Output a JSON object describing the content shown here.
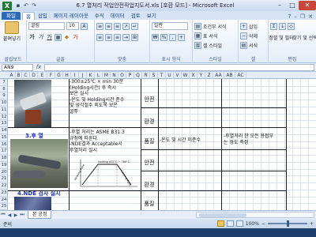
{
  "window": {
    "title": "6.7 열처리 작업안전작업지도서.xls [호환 모드] - Microsoft Excel",
    "app_icon": "X"
  },
  "ribbon_tabs": [
    "파일",
    "홈",
    "삽입",
    "페이지 레이아웃",
    "수식",
    "데이터",
    "검토",
    "보기"
  ],
  "ribbon": {
    "clipboard": {
      "label": "클립보드",
      "paste": "붙여넣기"
    },
    "font": {
      "label": "글꼴",
      "name": "굴림",
      "size": "10"
    },
    "alignment": {
      "label": "맞춤"
    },
    "number": {
      "label": "표시 형식",
      "format": "일반"
    },
    "styles": {
      "label": "스타일",
      "conditional": "조건부 서식",
      "table": "표 서식",
      "cell": "셀 스타일"
    },
    "cells": {
      "label": "셀",
      "insert": "삽입",
      "delete": "삭제",
      "format": "서식"
    },
    "editing": {
      "label": "편집",
      "sort": "정렬 및 필터",
      "find": "찾기 및 선택"
    }
  },
  "formula_bar": {
    "name_box": "AN9",
    "fx": "fx",
    "formula": ""
  },
  "columns": [
    "A",
    "B",
    "C",
    "D",
    "E",
    "F",
    "G",
    "H",
    "I",
    "J",
    "K",
    "L",
    "M",
    "N",
    "O",
    "P",
    "Q",
    "R",
    "S",
    "T",
    "U",
    "V",
    "W",
    "X",
    "Y",
    "Z",
    "AA",
    "AB",
    "AC"
  ],
  "rows": [
    "7",
    "8",
    "9",
    "10",
    "11",
    "12",
    "13",
    "14",
    "15",
    "16",
    "17",
    "18",
    "19",
    "20",
    "21",
    "22",
    "23",
    "24",
    "25"
  ],
  "sheet": {
    "step1_text": [
      "-300±25℃ × min 30분",
      "(Holding시간) 후 즉시",
      "보온 실시",
      "-온도 및 Holding시간 준수",
      "및 냉각절수 외도록 보온",
      "굴뿌"
    ],
    "step3_label": "3.후 열",
    "step3_text": [
      "-후열 처리는 ASME B31.3",
      "규정에 따른다.",
      "-NDE결과 Acceptable시",
      "후열처리 실시"
    ],
    "step4_label": "4.NDE 검사 실시",
    "cat_safety": "안전",
    "cat_env": "환경",
    "cat_quality": "품질",
    "quality_note_1": "-온도 및 시간 미준수",
    "quality_note_2": [
      "-후열처리 한 모든 용접부",
      "는 경도 측정"
    ],
    "graph": {
      "label_heating": "Heating Rate",
      "label_cooling": "Cooling Rate",
      "label_hold": "Holding 625°C ~ 760°C"
    }
  },
  "sheet_tab": "본 공정",
  "status": {
    "ready": "준비",
    "zoom": "100%"
  }
}
